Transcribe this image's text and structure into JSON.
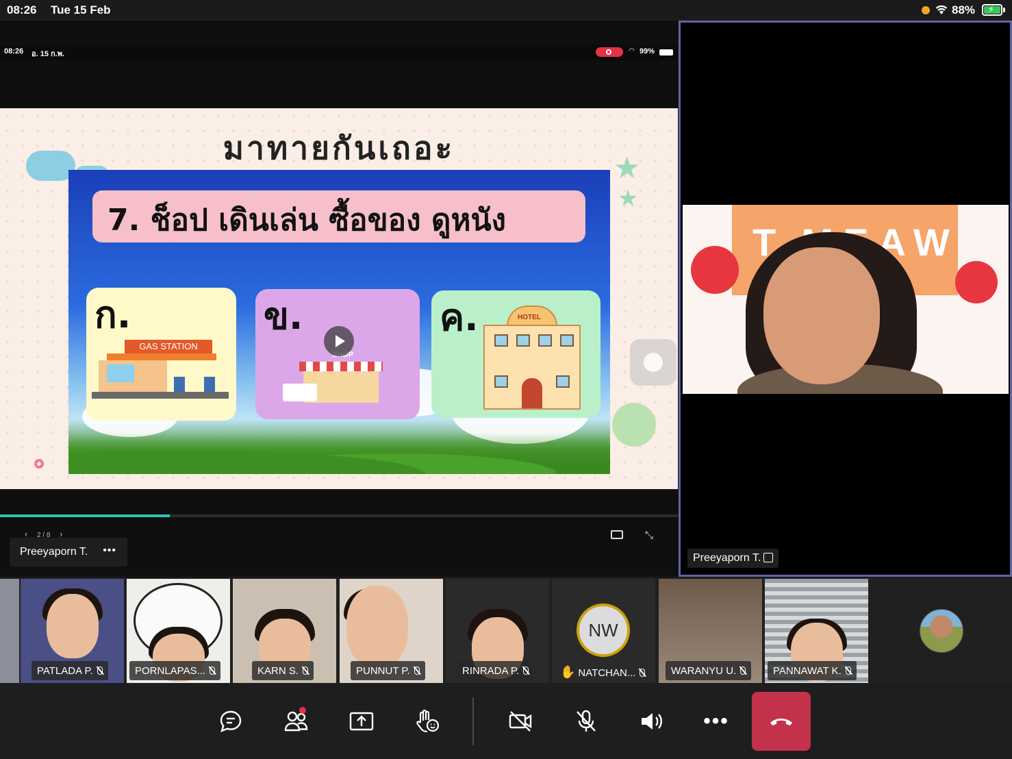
{
  "status_bar": {
    "time": "08:26",
    "date": "Tue 15 Feb",
    "battery": "88%"
  },
  "shared_screen": {
    "inner_status": {
      "time": "08:26",
      "date": "อ. 15 ก.พ.",
      "battery": "99%"
    },
    "slide": {
      "title": "มาทายกันเถอะ",
      "question": "7. ช็อป เดินเล่น ซื้อของ ดูหนัง",
      "choices": [
        {
          "label": "ก.",
          "sign": "GAS STATION"
        },
        {
          "label": "ข.",
          "sign": "SHOP"
        },
        {
          "label": "ค.",
          "sign": "HOTEL"
        }
      ]
    },
    "progress_fraction": 0.25,
    "page_indicator": "2 / 8",
    "presenter_label": "Preeyaporn T.",
    "more_label": "•••"
  },
  "presenter": {
    "name": "Preeyaporn T.",
    "background_text": "T.MEAW"
  },
  "participants": [
    {
      "name": "PATLADA P.",
      "muted": true
    },
    {
      "name": "PORNLAPAS...",
      "muted": true
    },
    {
      "name": "KARN S.",
      "muted": true
    },
    {
      "name": "PUNNUT P.",
      "muted": true
    },
    {
      "name": "RINRADA P.",
      "muted": true
    },
    {
      "name": "NATCHAN...",
      "initials": "NW",
      "hand_raised": true,
      "muted": true
    },
    {
      "name": "WARANYU U.",
      "muted": true
    },
    {
      "name": "PANNAWAT K.",
      "muted": true
    }
  ],
  "toolbar": {
    "buttons": [
      "chat-icon",
      "participants-icon",
      "share-screen-icon",
      "reactions-icon",
      "camera-off-icon",
      "mic-off-icon",
      "speaker-icon",
      "more-icon",
      "leave-icon"
    ],
    "more_label": "•••"
  },
  "colors": {
    "accent": "#6264a7",
    "leave": "#c4314b",
    "progress": "#2bc5b4",
    "hand": "#f5a623"
  }
}
